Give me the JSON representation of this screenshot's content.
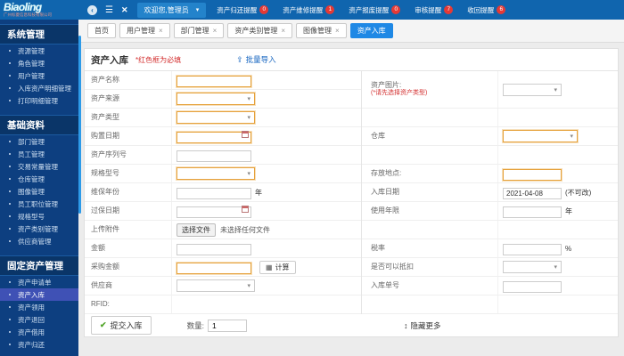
{
  "icons": {
    "collapse": "‹",
    "menu": "☰",
    "close": "✕",
    "caret": "▾",
    "tab_close": "×",
    "upload": "⇪",
    "updown": "↕",
    "check": "✔",
    "calc": "▦"
  },
  "colors": {
    "topbar": "#1065ae",
    "accent": "#1e88e5",
    "badge_red": "#e53935",
    "sidebar": "#0d3f80",
    "active_item": "#3f51b5",
    "required_orange": "#e6a23c",
    "danger_red": "#d32f2f",
    "link_blue": "#1565c0",
    "check_green": "#52a52a"
  },
  "topbar": {
    "logo": "Biaoling",
    "logo_sub": "广州标菱信息科技有限公司",
    "welcome": "欢迎您,管理员",
    "badges": [
      {
        "label": "资产归还提醒",
        "count": "0"
      },
      {
        "label": "资产维修提醒",
        "count": "1"
      },
      {
        "label": "资产报废提醒",
        "count": "0"
      },
      {
        "label": "审核提醒",
        "count": "7"
      },
      {
        "label": "收回提醒",
        "count": "6"
      }
    ]
  },
  "sidebar": {
    "sections": [
      {
        "title": "系统管理",
        "items": [
          "资源管理",
          "角色管理",
          "用户管理",
          "入库资产明细管理",
          "打印明细管理"
        ]
      },
      {
        "title": "基础资料",
        "items": [
          "部门管理",
          "员工管理",
          "交易常量管理",
          "仓库管理",
          "图像管理",
          "员工职位管理",
          "规格型号",
          "资产类别管理",
          "供应商管理"
        ]
      },
      {
        "title": "固定资产管理",
        "active": "资产入库",
        "items": [
          "资产申请单",
          "资产入库",
          "资产领用",
          "资产退回",
          "资产借用",
          "资产归还"
        ]
      }
    ]
  },
  "tabs": [
    {
      "label": "首页",
      "closable": false,
      "active": false
    },
    {
      "label": "用户管理",
      "closable": true,
      "active": false
    },
    {
      "label": "部门管理",
      "closable": true,
      "active": false
    },
    {
      "label": "资产类别管理",
      "closable": true,
      "active": false
    },
    {
      "label": "图像管理",
      "closable": true,
      "active": false
    },
    {
      "label": "资产入库",
      "closable": false,
      "active": true
    }
  ],
  "panel": {
    "title": "资产入库",
    "required_note": "*红色框为必填",
    "import_label": "批量导入"
  },
  "form": {
    "left_rows": [
      {
        "label": "资产名称",
        "control": {
          "type": "text",
          "required": true
        }
      },
      {
        "label": "资产来源",
        "control": {
          "type": "select",
          "required": true
        }
      },
      {
        "label": "资产类型",
        "control": {
          "type": "select",
          "required": true
        }
      },
      {
        "label": "购置日期",
        "control": {
          "type": "date",
          "required": true
        }
      },
      {
        "label": "资产序列号",
        "control": {
          "type": "text"
        }
      },
      {
        "label": "规格型号",
        "control": {
          "type": "select",
          "required": true
        }
      },
      {
        "label": "维保年份",
        "control": {
          "type": "text",
          "suffix": "年"
        }
      },
      {
        "label": "过保日期",
        "control": {
          "type": "date"
        }
      },
      {
        "label": "上传附件",
        "control": {
          "type": "file",
          "button_label": "选择文件",
          "status": "未选择任何文件"
        }
      },
      {
        "label": "金额",
        "control": {
          "type": "text"
        }
      },
      {
        "label": "采购金额",
        "control": {
          "type": "text",
          "required": true,
          "action_label": "计算"
        }
      },
      {
        "label": "供应商",
        "control": {
          "type": "select"
        }
      },
      {
        "label": "RFID:",
        "control": {
          "type": "none"
        }
      }
    ],
    "right_rows": [
      {
        "label": "资产图片:",
        "note": "(*请先选择资产类型)",
        "height": 42,
        "control": {
          "type": "select"
        }
      },
      {
        "label": "",
        "control": {
          "type": "none"
        }
      },
      {
        "label": "仓库",
        "control": {
          "type": "select",
          "required": true,
          "wide": true
        }
      },
      {
        "label": "",
        "control": {
          "type": "none"
        }
      },
      {
        "label": "存放地点:",
        "control": {
          "type": "text",
          "required": true
        }
      },
      {
        "label": "入库日期",
        "control": {
          "type": "text",
          "value": "2021-04-08",
          "suffix": "(不可改)"
        }
      },
      {
        "label": "使用年限",
        "control": {
          "type": "text",
          "suffix": "年"
        }
      },
      {
        "label": "",
        "control": {
          "type": "none"
        }
      },
      {
        "label": "税率",
        "control": {
          "type": "text",
          "suffix": "%"
        }
      },
      {
        "label": "是否可以抵扣",
        "control": {
          "type": "select"
        }
      },
      {
        "label": "入库单号",
        "control": {
          "type": "text"
        }
      },
      {
        "label": "",
        "control": {
          "type": "none"
        }
      }
    ]
  },
  "footer": {
    "submit_label": "提交入库",
    "qty_label": "数量:",
    "qty_value": "1",
    "hide_more": "隐藏更多"
  }
}
